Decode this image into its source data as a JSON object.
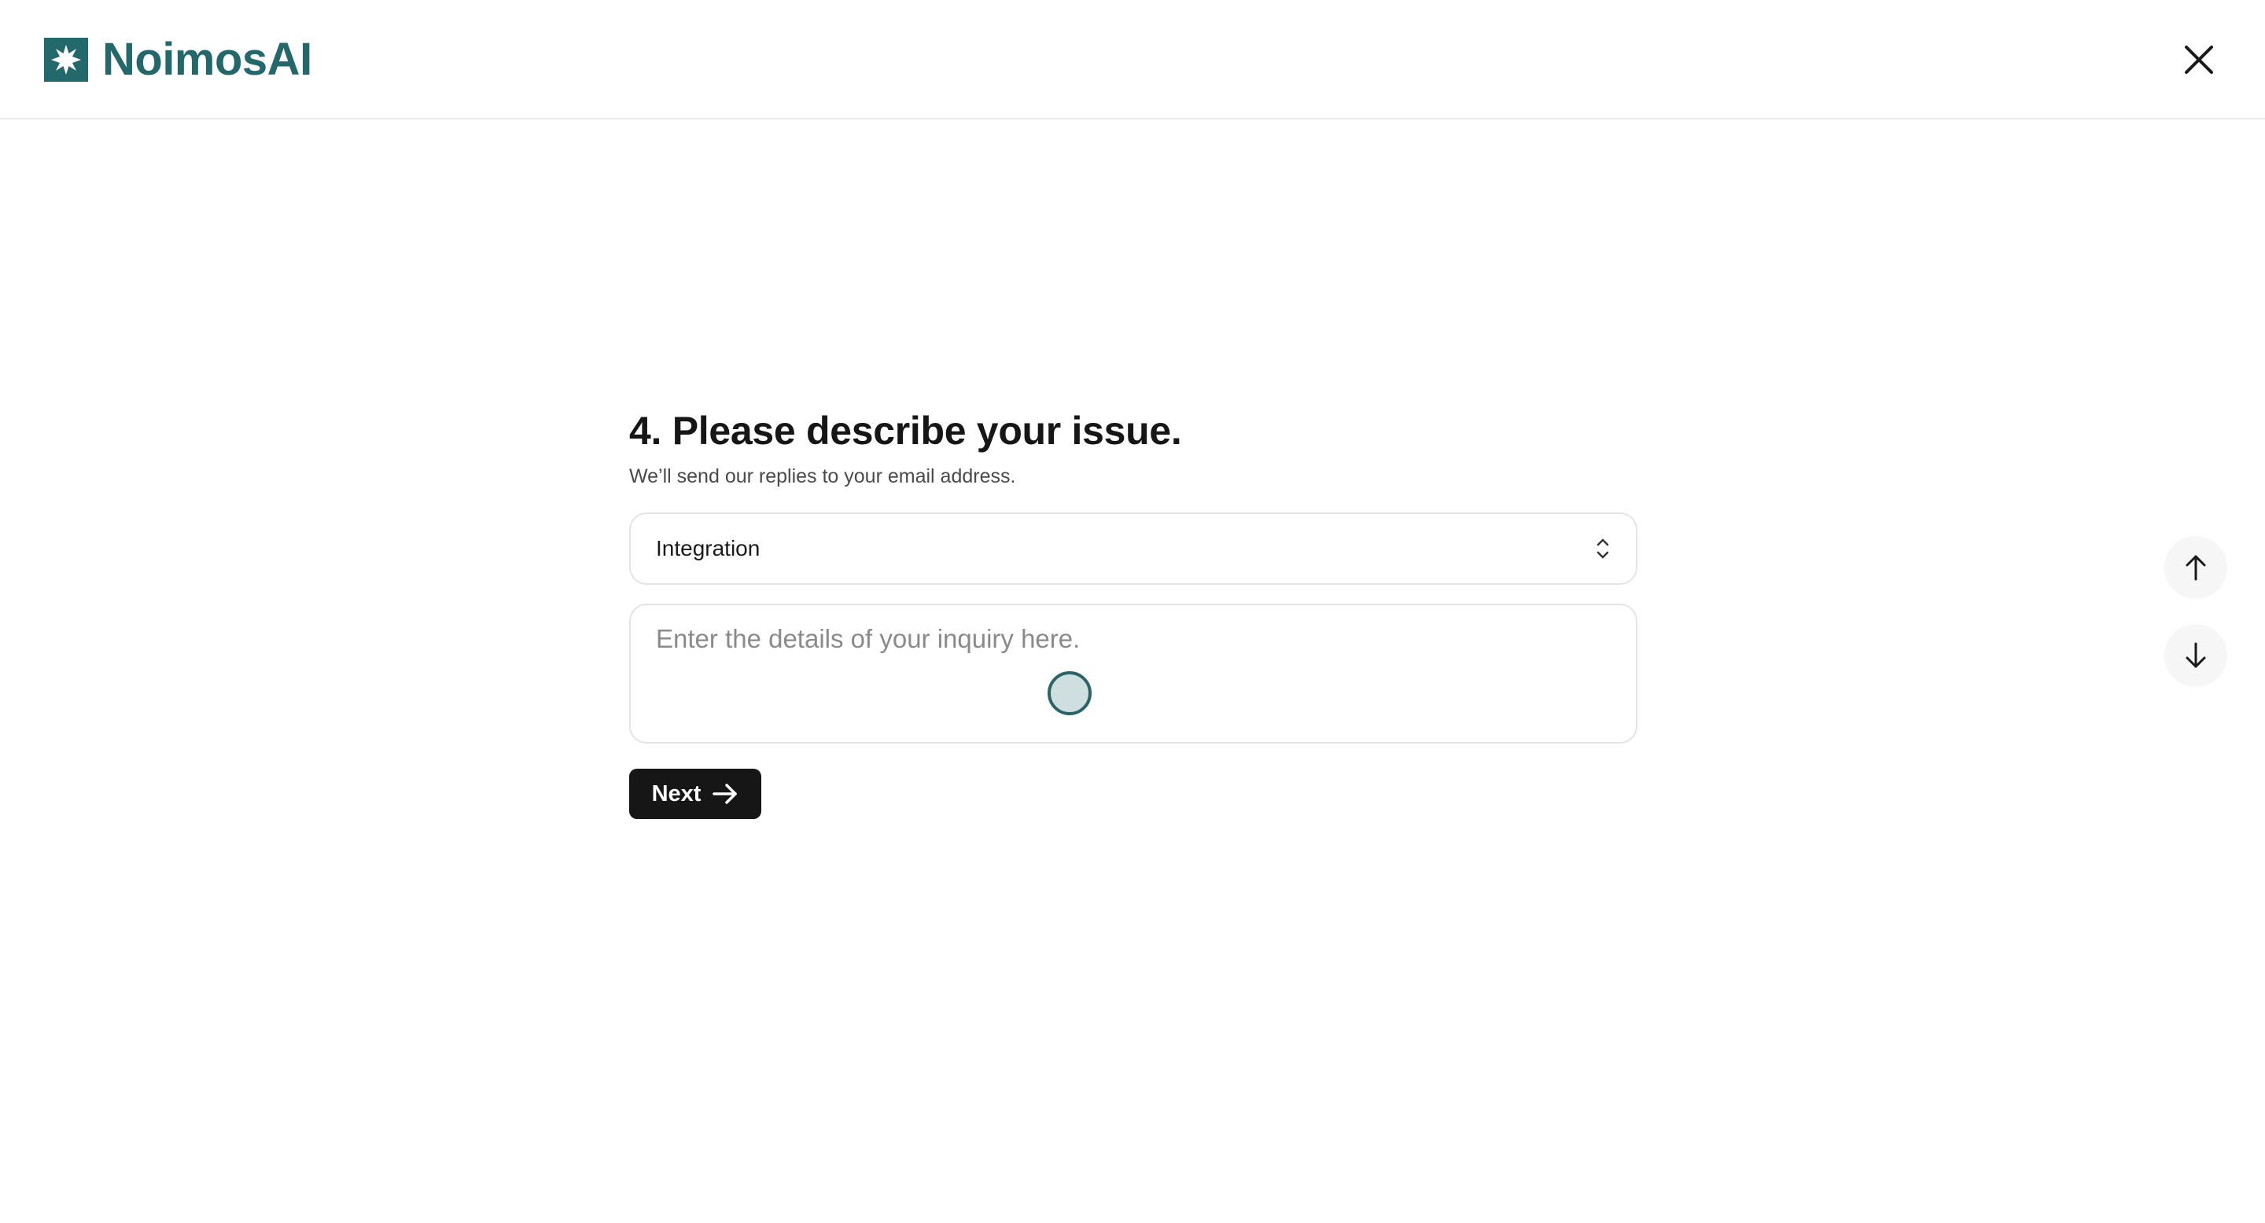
{
  "colors": {
    "brand": "#23686b",
    "button_bg": "#161616"
  },
  "header": {
    "logo_text": "NoimosAI",
    "logo_icon": "starburst-icon",
    "close_icon": "close-icon"
  },
  "form": {
    "question_title": "4. Please describe your issue.",
    "question_subtitle": "We’ll send our replies to your email address.",
    "category_select": {
      "value": "Integration",
      "icon": "chevron-up-down-icon"
    },
    "details_textarea": {
      "placeholder": "Enter the details of your inquiry here.",
      "value": ""
    },
    "next_button": {
      "label": "Next",
      "icon": "arrow-right-icon"
    }
  },
  "navigation": {
    "up_icon": "arrow-up-icon",
    "down_icon": "arrow-down-icon"
  }
}
